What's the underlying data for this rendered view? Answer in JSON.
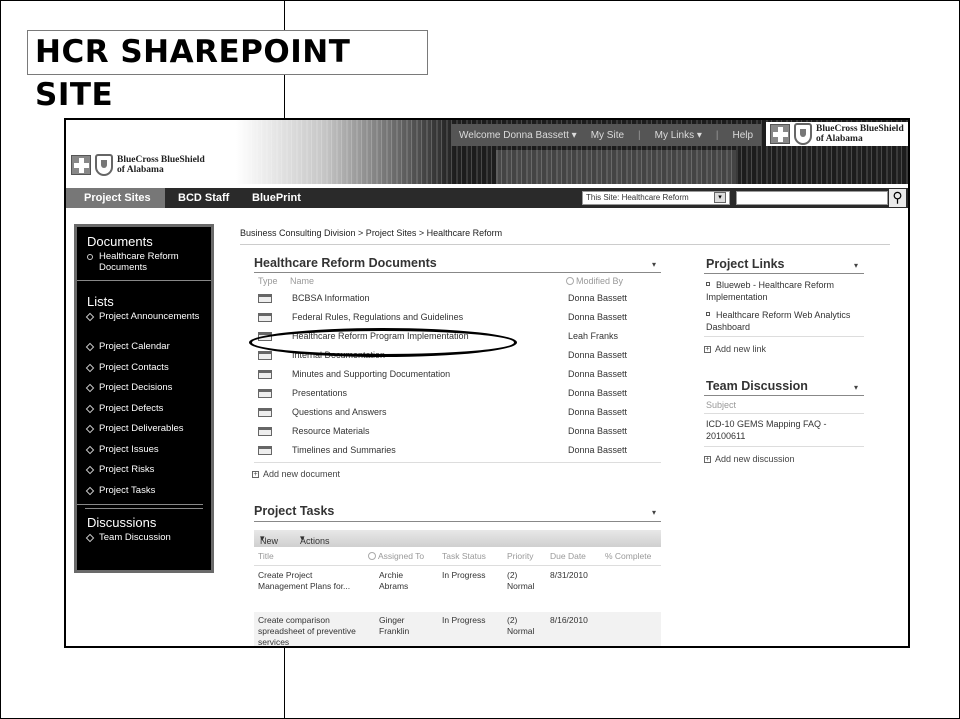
{
  "slide": {
    "title": "HCR SHAREPOINT SITE"
  },
  "header": {
    "welcome": "Welcome Donna Bassett",
    "my_site": "My Site",
    "my_links": "My Links",
    "help": "Help",
    "logo_text_line1": "BlueCross BlueShield",
    "logo_text_line2": "of Alabama",
    "icons": [
      "blue-cross-icon",
      "blue-shield-icon",
      "dropdown-arrow-icon",
      "search-icon"
    ]
  },
  "nav": {
    "tabs": [
      "Project Sites",
      "BCD Staff",
      "BluePrint"
    ],
    "scope": "This Site: Healthcare Reform",
    "scope_arrow": "▾",
    "search_glyph": "⚲"
  },
  "breadcrumb": "Business Consulting Division > Project Sites > Healthcare Reform",
  "quicklaunch": {
    "documents_heading": "Documents",
    "documents_items": [
      "Healthcare Reform Documents"
    ],
    "lists_heading": "Lists",
    "lists_items": [
      "Project Announcements",
      "Project Calendar",
      "Project Contacts",
      "Project Decisions",
      "Project Defects",
      "Project Deliverables",
      "Project Issues",
      "Project Risks",
      "Project Tasks"
    ],
    "discussions_heading": "Discussions",
    "discussions_items": [
      "Team Discussion"
    ]
  },
  "documents": {
    "title": "Healthcare Reform Documents",
    "menu_glyph": "▾",
    "col_type": "Type",
    "col_name": "Name",
    "col_modified_by": "Modified By",
    "rows": [
      {
        "name": "BCBSA Information",
        "by": "Donna Bassett"
      },
      {
        "name": "Federal Rules, Regulations and Guidelines",
        "by": "Donna Bassett"
      },
      {
        "name": "Healthcare Reform Program Implementation",
        "by": "Leah Franks"
      },
      {
        "name": "Internal Documentation",
        "by": "Donna Bassett"
      },
      {
        "name": "Minutes and Supporting Documentation",
        "by": "Donna Bassett"
      },
      {
        "name": "Presentations",
        "by": "Donna Bassett"
      },
      {
        "name": "Questions and Answers",
        "by": "Donna Bassett"
      },
      {
        "name": "Resource Materials",
        "by": "Donna Bassett"
      },
      {
        "name": "Timelines and Summaries",
        "by": "Donna Bassett"
      }
    ],
    "add_new": "Add new document"
  },
  "tasks": {
    "title": "Project Tasks",
    "menu_glyph": "▾",
    "toolbar_new": "New",
    "toolbar_actions": "Actions",
    "columns": [
      "Title",
      "Assigned To",
      "Task Status",
      "Priority",
      "Due Date",
      "% Complete"
    ],
    "rows": [
      {
        "title": "Create Project Management Plans for...",
        "assigned": "Archie Abrams",
        "status": "In Progress",
        "priority": "(2) Normal",
        "due": "8/31/2010",
        "complete": ""
      },
      {
        "title": "Create comparison spreadsheet of preventive services",
        "assigned": "Ginger Franklin",
        "status": "In Progress",
        "priority": "(2) Normal",
        "due": "8/16/2010",
        "complete": ""
      }
    ]
  },
  "project_links": {
    "title": "Project Links",
    "menu_glyph": "▾",
    "items": [
      "Blueweb - Healthcare Reform Implementation",
      "Healthcare Reform Web Analytics Dashboard"
    ],
    "add_new": "Add new link"
  },
  "team_discussion": {
    "title": "Team Discussion",
    "menu_glyph": "▾",
    "col_subject": "Subject",
    "items": [
      "ICD-10 GEMS Mapping FAQ - 20100611"
    ],
    "add_new": "Add new discussion"
  },
  "colors": {
    "nav_bar": "#2a2a2a",
    "quicklaunch_bg": "#000000",
    "active_tab": "#777777"
  }
}
